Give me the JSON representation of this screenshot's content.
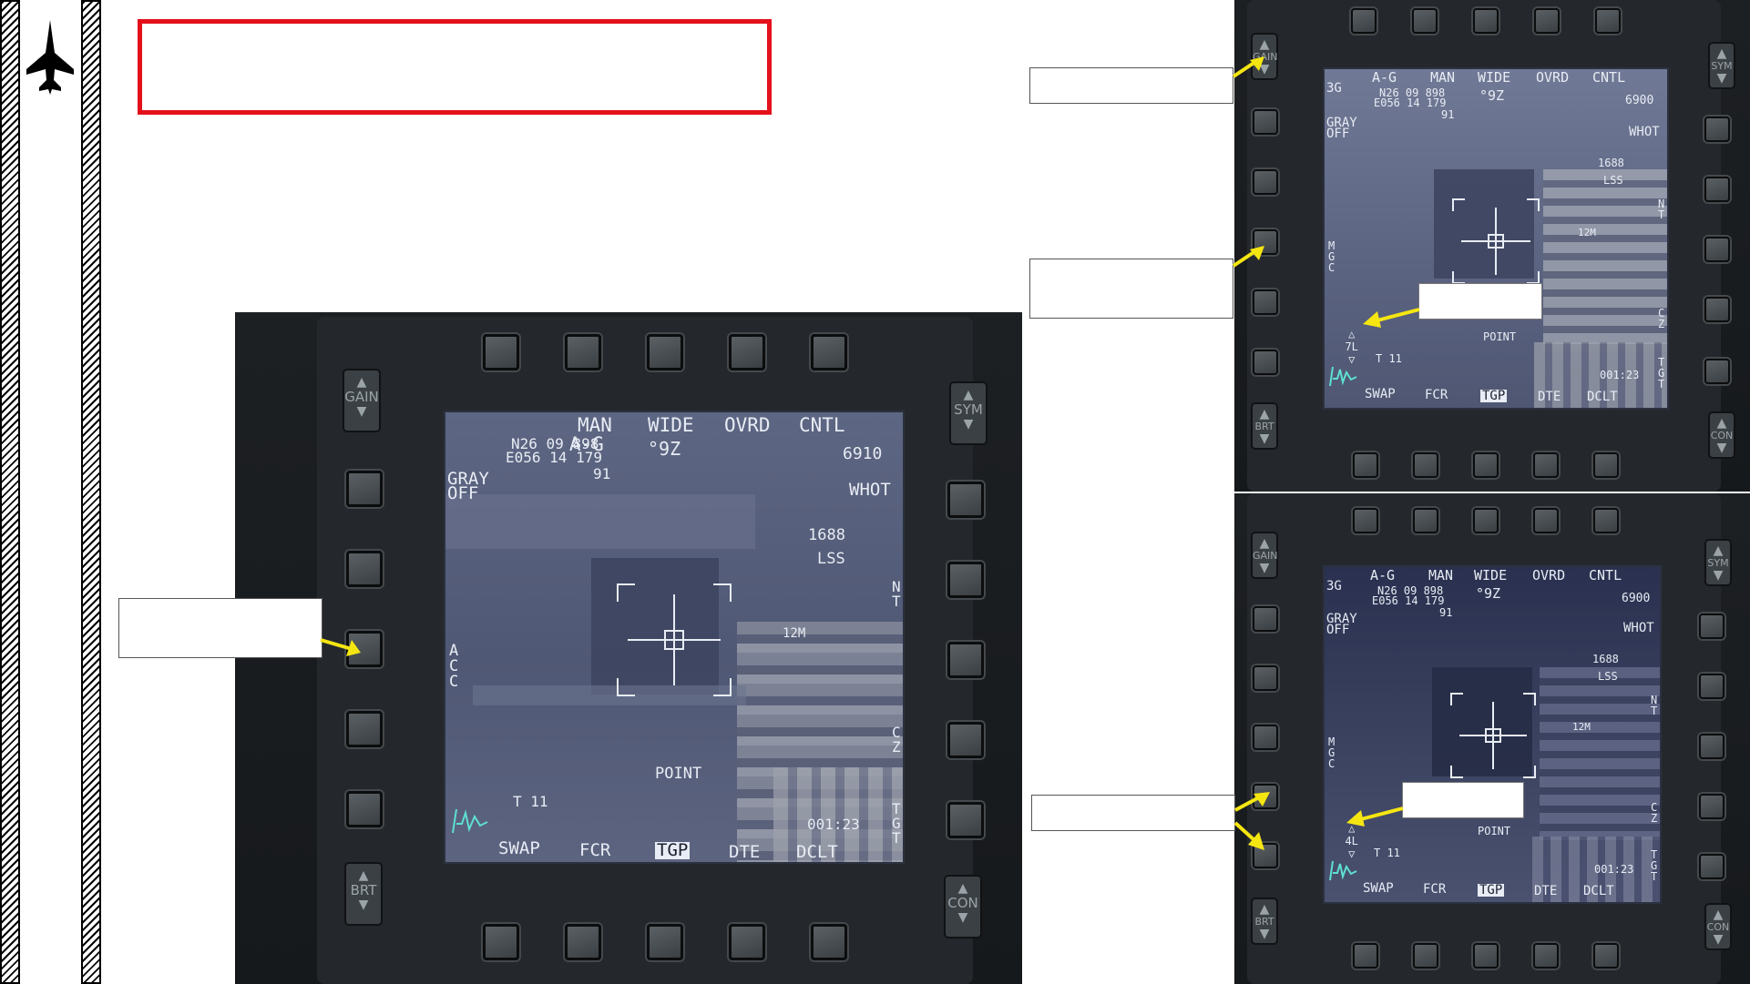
{
  "colors": {
    "accent_red": "#e3101a",
    "arrow_yellow": "#f5e612",
    "screen_text": "#e8ecf4"
  },
  "icons": {
    "aircraft": "jet-silhouette-icon"
  },
  "main_mfd": {
    "rocker_left_top": "GAIN",
    "rocker_left_bottom": "BRT",
    "rocker_right_top": "SYM",
    "rocker_right_bottom": "CON",
    "screen": {
      "top_labels": [
        "A-G",
        "MAN",
        "WIDE",
        "OVRD",
        "CNTL"
      ],
      "coord_n": "N26 09 898",
      "coord_e": "E056 14 179",
      "coord_alt": "91",
      "heading": "°9Z",
      "altitude": "6910",
      "gray": "GRAY",
      "gray_state": "OFF",
      "whot": "WHOT",
      "range": "1688",
      "lss": "LSS",
      "left_vertical": [
        "A",
        "C",
        "C"
      ],
      "right_nt": [
        "N",
        "T"
      ],
      "right_cz": [
        "C",
        "Z"
      ],
      "right_tgt": [
        "T",
        "G",
        "T"
      ],
      "point": "POINT",
      "t_value": "T 11",
      "time": "001:23",
      "marker": "12M",
      "bottom_labels": [
        "SWAP",
        "FCR",
        "TGP",
        "DTE",
        "DCLT"
      ]
    }
  },
  "small_mfds": [
    {
      "rocker_left_top": "GAIN",
      "rocker_left_bottom": "BRT",
      "rocker_right_top": "SYM",
      "rocker_right_bottom": "CON",
      "screen": {
        "mode": "3G",
        "top_labels": [
          "A-G",
          "MAN",
          "WIDE",
          "OVRD",
          "CNTL"
        ],
        "coord_n": "N26 09 898",
        "coord_e": "E056 14 179",
        "coord_alt": "91",
        "heading": "°9Z",
        "altitude": "6900",
        "gray": "GRAY",
        "gray_state": "OFF",
        "whot": "WHOT",
        "range": "1688",
        "lss": "LSS",
        "left_vertical": [
          "M",
          "G",
          "C"
        ],
        "right_nt": [
          "N",
          "T"
        ],
        "right_cz": [
          "C",
          "Z"
        ],
        "right_tgt": [
          "T",
          "G",
          "T"
        ],
        "stepper": "7L",
        "point": "POINT",
        "t_value": "T 11",
        "time": "001:23",
        "marker": "12M",
        "bottom_labels": [
          "SWAP",
          "FCR",
          "TGP",
          "DTE",
          "DCLT"
        ]
      }
    },
    {
      "rocker_left_top": "GAIN",
      "rocker_left_bottom": "BRT",
      "rocker_right_top": "SYM",
      "rocker_right_bottom": "CON",
      "screen": {
        "mode": "3G",
        "top_labels": [
          "A-G",
          "MAN",
          "WIDE",
          "OVRD",
          "CNTL"
        ],
        "coord_n": "N26 09 898",
        "coord_e": "E056 14 179",
        "coord_alt": "91",
        "heading": "°9Z",
        "altitude": "6900",
        "gray": "GRAY",
        "gray_state": "OFF",
        "whot": "WHOT",
        "range": "1688",
        "lss": "LSS",
        "left_vertical": [
          "M",
          "G",
          "C"
        ],
        "right_nt": [
          "N",
          "T"
        ],
        "right_cz": [
          "C",
          "Z"
        ],
        "right_tgt": [
          "T",
          "G",
          "T"
        ],
        "stepper": "4L",
        "point": "POINT",
        "t_value": "T 11",
        "time": "001:23",
        "marker": "12M",
        "bottom_labels": [
          "SWAP",
          "FCR",
          "TGP",
          "DTE",
          "DCLT"
        ]
      }
    }
  ]
}
